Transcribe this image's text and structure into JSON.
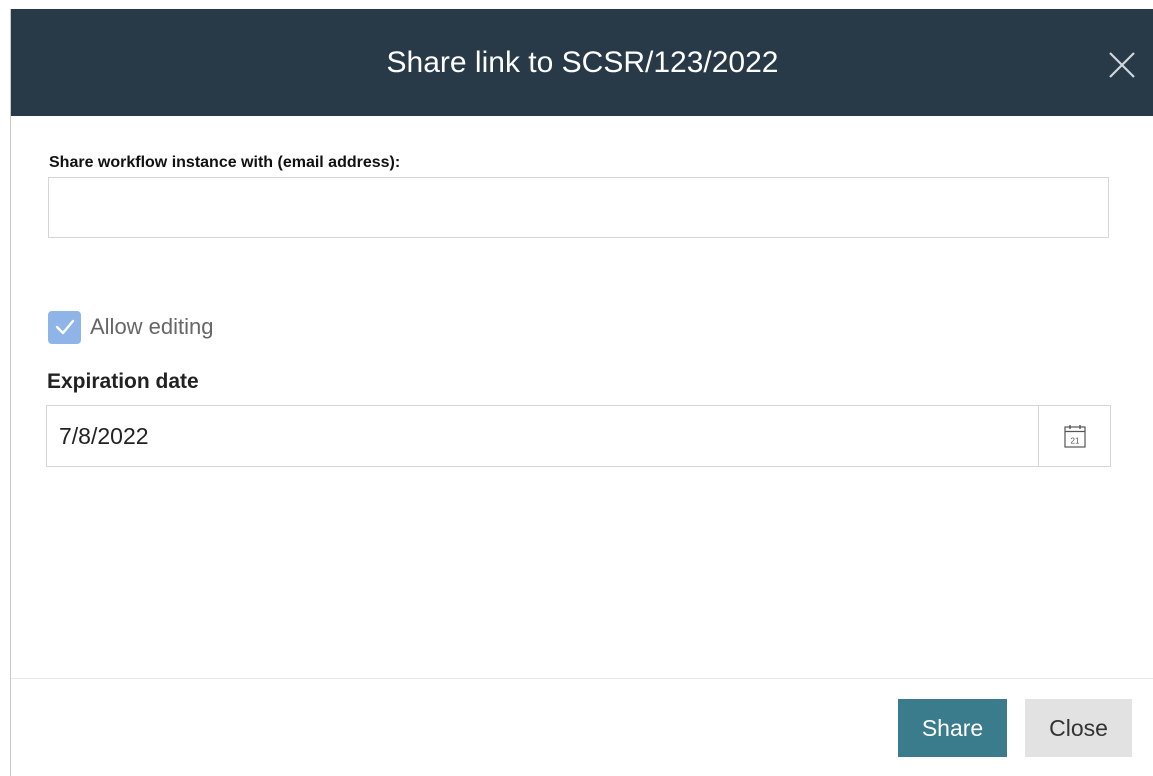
{
  "dialog": {
    "title": "Share link to SCSR/123/2022",
    "header_color": "#283948"
  },
  "form": {
    "email_label": "Share workflow instance with (email address):",
    "email_value": "",
    "email_placeholder": "",
    "allow_editing_label": "Allow editing",
    "allow_editing_checked": true,
    "expiration_label": "Expiration date",
    "expiration_value": "7/8/2022",
    "calendar_icon_day": "21"
  },
  "footer": {
    "share_label": "Share",
    "close_label": "Close",
    "share_color": "#3a7b8c"
  },
  "icons": {
    "close": "close-icon",
    "checkbox": "checkmark-icon",
    "calendar": "calendar-icon"
  }
}
